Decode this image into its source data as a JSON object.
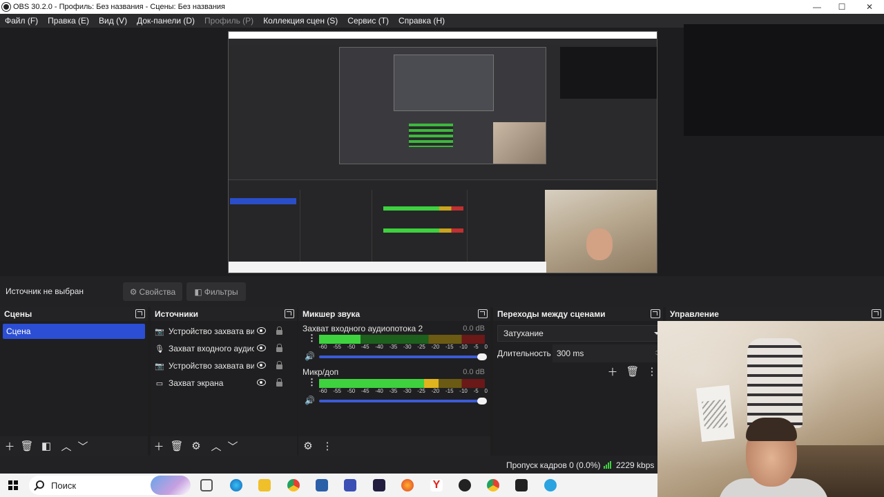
{
  "window": {
    "title": "OBS 30.2.0 - Профиль: Без названия - Сцены: Без названия",
    "minimize": "—",
    "maximize": "☐",
    "close": "✕"
  },
  "menu": [
    {
      "label": "Файл (F)",
      "enabled": true
    },
    {
      "label": "Правка (E)",
      "enabled": true
    },
    {
      "label": "Вид (V)",
      "enabled": true
    },
    {
      "label": "Док-панели (D)",
      "enabled": true
    },
    {
      "label": "Профиль (P)",
      "enabled": false
    },
    {
      "label": "Коллекция сцен (S)",
      "enabled": true
    },
    {
      "label": "Сервис (T)",
      "enabled": true
    },
    {
      "label": "Справка (H)",
      "enabled": true
    }
  ],
  "source_toolbar": {
    "no_source": "Источник не выбран",
    "properties": "Свойства",
    "filters": "Фильтры"
  },
  "scenes": {
    "title": "Сцены",
    "items": [
      "Сцена"
    ],
    "selected": "Сцена"
  },
  "sources": {
    "title": "Источники",
    "items": [
      {
        "label": "Устройство захвата видео",
        "icon": "camera-icon"
      },
      {
        "label": "Захват входного аудиопотока",
        "icon": "microphone-icon"
      },
      {
        "label": "Устройство захвата видео",
        "icon": "camera-icon"
      },
      {
        "label": "Захват экрана",
        "icon": "monitor-icon"
      }
    ]
  },
  "mixer": {
    "title": "Микшер звука",
    "ticks": [
      "-60",
      "-55",
      "-50",
      "-45",
      "-40",
      "-35",
      "-30",
      "-25",
      "-20",
      "-15",
      "-10",
      "-5",
      "0"
    ],
    "channels": [
      {
        "name": "Захват входного аудиопотока 2",
        "db": "0.0 dB",
        "level": 0.25,
        "volume": 1.0
      },
      {
        "name": "Микр/доп",
        "db": "0.0 dB",
        "level": 0.72,
        "volume": 1.0
      }
    ]
  },
  "transitions": {
    "title": "Переходы между сценами",
    "selected": "Затухание",
    "duration_label": "Длительность",
    "duration_value": "300 ms"
  },
  "controls": {
    "title": "Управление"
  },
  "status": {
    "dropped_frames": "Пропуск кадров 0 (0.0%)",
    "bitrate": "2229 kbps",
    "network_color": "#3fd23f"
  },
  "taskbar": {
    "search_placeholder": "Поиск",
    "apps": [
      "task-view-icon",
      "edge-icon",
      "file-explorer-icon",
      "chrome-icon",
      "app-icon",
      "app-icon",
      "obs-icon",
      "firefox-icon",
      "yandex-icon",
      "obs-icon",
      "chrome-icon",
      "game-icon",
      "telegram-icon"
    ]
  },
  "colors": {
    "accent": "#2c4ed4",
    "background": "#1f1f21"
  }
}
